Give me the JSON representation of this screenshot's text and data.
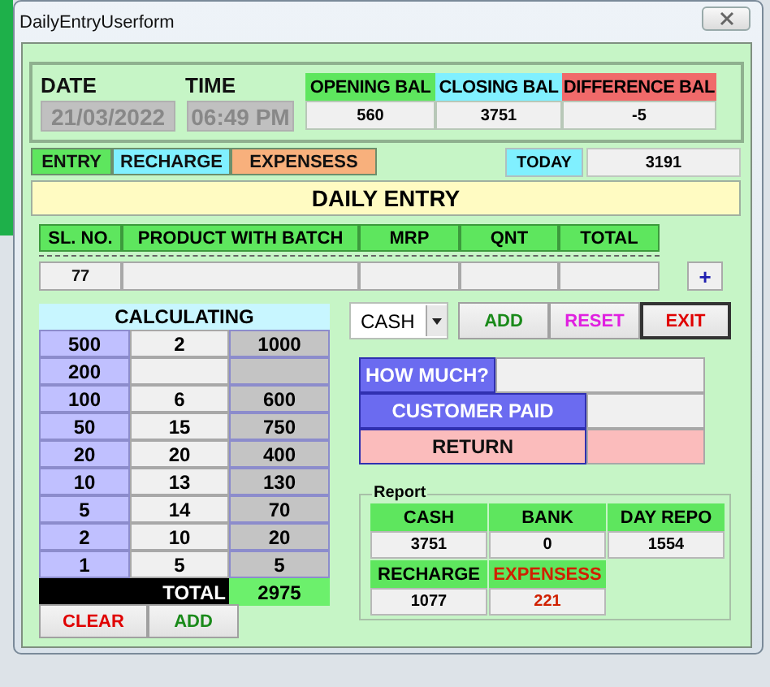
{
  "window": {
    "title": "DailyEntryUserform"
  },
  "date": {
    "label": "DATE",
    "value": "21/03/2022",
    "disabled": true
  },
  "time": {
    "label": "TIME",
    "value": "06:49 PM",
    "disabled": true
  },
  "balances": [
    {
      "label": "OPENING BAL",
      "value": "560",
      "color": "#5ee65e"
    },
    {
      "label": "CLOSING BAL",
      "value": "3751",
      "color": "#80f0ff"
    },
    {
      "label": "DIFFERENCE BAL",
      "value": "-5",
      "color": "#f06a6a"
    }
  ],
  "tabs": [
    {
      "label": "ENTRY",
      "color": "#5ee65e"
    },
    {
      "label": "RECHARGE",
      "color": "#80f0ff"
    },
    {
      "label": "EXPENSESS",
      "color": "#f8b07c"
    }
  ],
  "today": {
    "label": "TODAY",
    "value": "3191"
  },
  "banner": "DAILY ENTRY",
  "entry_table": {
    "columns": [
      "SL. NO.",
      "PRODUCT WITH BATCH",
      "MRP",
      "QNT",
      "TOTAL"
    ],
    "inputs": [
      "77"
    ]
  },
  "add_row_button": "+",
  "calculator": {
    "title": "CALCULATING",
    "rows": [
      {
        "note": "500",
        "count": "2",
        "amount": "1000"
      },
      {
        "note": "200"
      },
      {
        "note": "100",
        "count": "6",
        "amount": "600"
      },
      {
        "note": "50",
        "count": "15",
        "amount": "750"
      },
      {
        "note": "20",
        "count": "20",
        "amount": "400"
      },
      {
        "note": "10",
        "count": "13",
        "amount": "130"
      },
      {
        "note": "5",
        "count": "14",
        "amount": "70"
      },
      {
        "note": "2",
        "count": "10",
        "amount": "20"
      },
      {
        "note": "1",
        "count": "5",
        "amount": "5"
      }
    ],
    "total_label": "TOTAL",
    "total": "2975"
  },
  "calc_buttons": [
    {
      "label": "CLEAR",
      "color": "#e00000"
    },
    {
      "label": "ADD",
      "color": "#1a8a1a"
    }
  ],
  "payment_mode": {
    "value": "CASH"
  },
  "actions": [
    {
      "label": "ADD",
      "color": "#1a8a1a",
      "default": false
    },
    {
      "label": "RESET",
      "color": "#e020e0",
      "default": false
    },
    {
      "label": "EXIT",
      "color": "#e00000",
      "default": true
    }
  ],
  "change": [
    {
      "label": "HOW MUCH?",
      "color": "#6b6bf0"
    },
    {
      "label": "CUSTOMER PAID",
      "color": "#6b6bf0"
    },
    {
      "label": "RETURN",
      "color": "#fbbcbc"
    }
  ],
  "report": {
    "title": "Report",
    "items": [
      {
        "label": "CASH",
        "value": "3751",
        "highlight": false
      },
      {
        "label": "BANK",
        "value": "0",
        "highlight": false
      },
      {
        "label": "DAY REPO",
        "value": "1554",
        "highlight": false
      },
      {
        "label": "RECHARGE",
        "value": "1077",
        "highlight": false
      },
      {
        "label": "EXPENSESS",
        "value": "221",
        "highlight": true
      }
    ]
  }
}
